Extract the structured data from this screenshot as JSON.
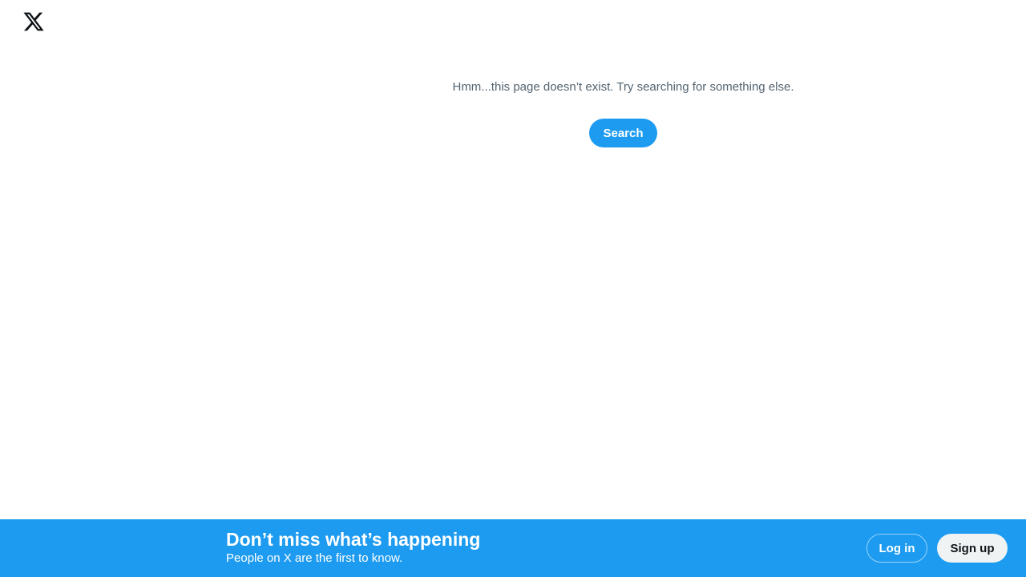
{
  "header": {
    "logo_icon": "x-logo-icon"
  },
  "error": {
    "message": "Hmm...this page doesn’t exist. Try searching for something else.",
    "search_label": "Search"
  },
  "bottom_bar": {
    "title": "Don’t miss what’s happening",
    "subtitle": "People on X are the first to know.",
    "login_label": "Log in",
    "signup_label": "Sign up"
  },
  "colors": {
    "brand_blue": "#1d9bf0",
    "secondary_text": "#536471",
    "signup_bg": "#eff3f4",
    "dark_text": "#0f1419"
  }
}
